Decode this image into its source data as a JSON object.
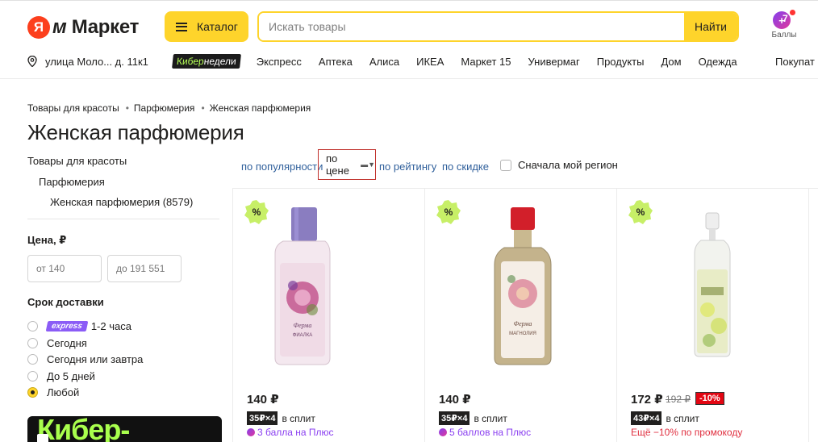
{
  "header": {
    "logo_ya": "Я",
    "logo_m": "м",
    "logo_text": "Маркет",
    "catalog_label": "Каталог",
    "search_placeholder": "Искать товары",
    "search_button": "Найти",
    "points_label": "Баллы",
    "points_value": "7"
  },
  "nav": {
    "address": "улица Моло... д. 11к1",
    "kiber_a": "Кибер",
    "kiber_b": "недели",
    "items": [
      "Экспресс",
      "Аптека",
      "Алиса",
      "ИКЕА",
      "Маркет 15",
      "Универмаг",
      "Продукты",
      "Дом",
      "Одежда"
    ],
    "buyers": "Покупат"
  },
  "breadcrumbs": [
    "Товары для красоты",
    "Парфюмерия",
    "Женская парфюмерия"
  ],
  "page_title": "Женская парфюмерия",
  "sidebar": {
    "categories": [
      "Товары для красоты",
      "Парфюмерия",
      "Женская парфюмерия (8579)"
    ],
    "price_heading": "Цена, ₽",
    "price_from": "от 140",
    "price_to": "до 191 551",
    "delivery_heading": "Срок доставки",
    "express_badge": "express",
    "delivery_options": [
      "1-2 часа",
      "Сегодня",
      "Сегодня или завтра",
      "До 5 дней",
      "Любой"
    ],
    "delivery_selected": 4,
    "banner_text": "Кибер-"
  },
  "sort": {
    "popularity": "по популярности",
    "price": "по цене",
    "rating": "по рейтингу",
    "discount": "по скидке",
    "region": "Сначала мой регион"
  },
  "products": [
    {
      "badge": "%",
      "price": "140 ₽",
      "split": "35₽×4",
      "split_text": "в сплит",
      "extra": "3 балла на Плюс",
      "label_top": "Ферма",
      "label_bottom": "ФИАЛКА"
    },
    {
      "badge": "%",
      "price": "140 ₽",
      "split": "35₽×4",
      "split_text": "в сплит",
      "extra": "5 баллов на Плюс",
      "label_top": "Ферма",
      "label_bottom": "МАГНОЛИЯ"
    },
    {
      "badge": "%",
      "price": "172 ₽",
      "old_price": "192 ₽",
      "discount": "-10%",
      "split": "43₽×4",
      "split_text": "в сплит",
      "extra": "Ещё −10% по промокоду"
    }
  ],
  "colors": {
    "accent": "#fed42b",
    "logo_red": "#fc3f1d",
    "link": "#2f5f9b",
    "plus": "#8a3ff0",
    "discount": "#e30613"
  }
}
